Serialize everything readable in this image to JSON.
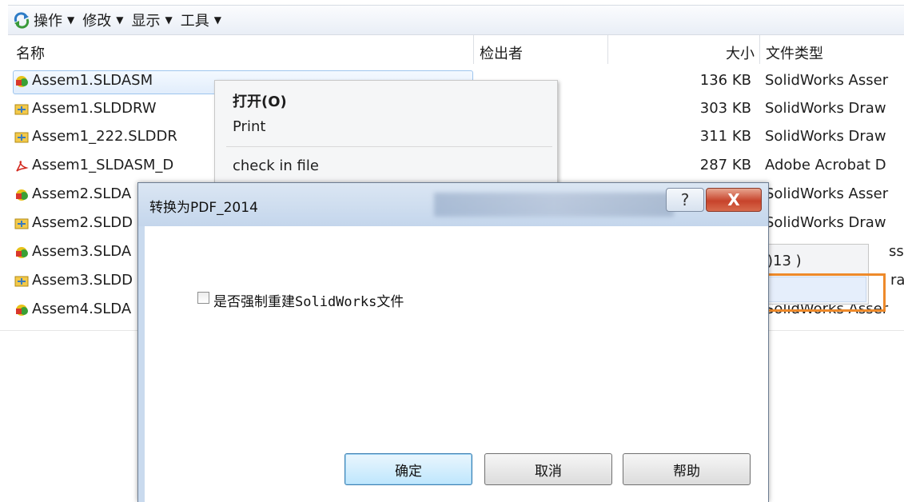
{
  "toolbar": {
    "icon": "refresh-icon",
    "menus": [
      {
        "label": "操作"
      },
      {
        "label": "修改"
      },
      {
        "label": "显示"
      },
      {
        "label": "工具"
      }
    ]
  },
  "columns": {
    "name": "名称",
    "checked_out_by": "检出者",
    "size": "大小",
    "type": "文件类型"
  },
  "files": [
    {
      "name": "Assem1.SLDASM",
      "size": "136 KB",
      "type": "SolidWorks Asser",
      "icon": "assembly-icon"
    },
    {
      "name": "Assem1.SLDDRW",
      "size": "303 KB",
      "type": "SolidWorks Draw",
      "icon": "drawing-icon"
    },
    {
      "name": "Assem1_222.SLDDR",
      "size": "311 KB",
      "type": "SolidWorks Draw",
      "icon": "drawing-icon"
    },
    {
      "name": "Assem1_SLDASM_D",
      "size": "287 KB",
      "type": "Adobe Acrobat D",
      "icon": "pdf-icon"
    },
    {
      "name": "Assem2.SLDA",
      "size": "",
      "type": "SolidWorks Asser",
      "icon": "assembly-icon"
    },
    {
      "name": "Assem2.SLDD",
      "size": "",
      "type": "SolidWorks Draw",
      "icon": "drawing-icon"
    },
    {
      "name": "Assem3.SLDA",
      "size": "",
      "type": "sser",
      "icon": "assembly-icon"
    },
    {
      "name": "Assem3.SLDD",
      "size": "",
      "type": "raw",
      "icon": "drawing-icon"
    },
    {
      "name": "Assem4.SLDA",
      "size": "",
      "type": "SolidWorks Asser",
      "icon": "assembly-icon"
    }
  ],
  "context_menu": {
    "open": "打开(O)",
    "print": "Print",
    "check_in": "check in file"
  },
  "submenu_fragment": {
    "text": ")13 )"
  },
  "dialog": {
    "title": "转换为PDF_2014",
    "help_glyph": "?",
    "close_glyph": "X",
    "checkbox_label": "是否强制重建SolidWorks文件",
    "checkbox_checked": false,
    "ok": "确定",
    "cancel": "取消",
    "help": "帮助"
  },
  "colors": {
    "highlight_box": "#ee8a2a",
    "dialog_frame": "#c9daee",
    "close_button": "#c7432b"
  }
}
